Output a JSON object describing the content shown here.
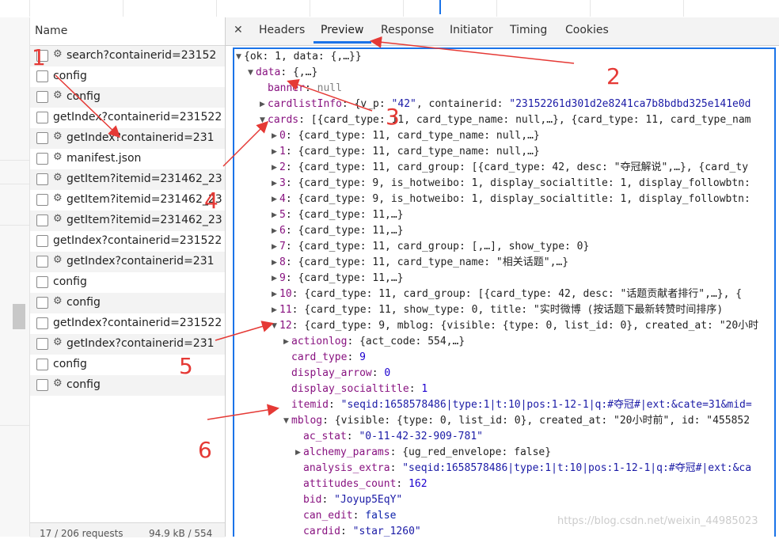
{
  "network": {
    "name_header": "Name",
    "requests": [
      {
        "label": "search?containerid=23152",
        "gear": true,
        "alt": true
      },
      {
        "label": "config",
        "gear": false,
        "alt": false
      },
      {
        "label": "config",
        "gear": true,
        "alt": true
      },
      {
        "label": "getIndex?containerid=231522",
        "gear": false,
        "alt": false
      },
      {
        "label": "getIndex?containerid=231",
        "gear": true,
        "alt": true
      },
      {
        "label": "manifest.json",
        "gear": true,
        "alt": false
      },
      {
        "label": "getItem?itemid=231462_23",
        "gear": true,
        "alt": true
      },
      {
        "label": "getItem?itemid=231462_23",
        "gear": true,
        "alt": false
      },
      {
        "label": "getItem?itemid=231462_23",
        "gear": true,
        "alt": true
      },
      {
        "label": "getIndex?containerid=231522",
        "gear": false,
        "alt": false
      },
      {
        "label": "getIndex?containerid=231",
        "gear": true,
        "alt": true
      },
      {
        "label": "config",
        "gear": false,
        "alt": false
      },
      {
        "label": "config",
        "gear": true,
        "alt": true
      },
      {
        "label": "getIndex?containerid=231522",
        "gear": false,
        "alt": false
      },
      {
        "label": "getIndex?containerid=231",
        "gear": true,
        "alt": true
      },
      {
        "label": "config",
        "gear": false,
        "alt": false
      },
      {
        "label": "config",
        "gear": true,
        "alt": true
      }
    ],
    "footer_requests": "17 / 206 requests",
    "footer_size": "94.9 kB / 554"
  },
  "tabs": {
    "close_glyph": "✕",
    "items": [
      "Headers",
      "Preview",
      "Response",
      "Initiator",
      "Timing",
      "Cookies"
    ],
    "active": "Preview"
  },
  "preview_lines": [
    {
      "tri": "open",
      "parts": [
        [
          "p",
          "{ok: 1, data: {,…}}"
        ]
      ]
    },
    {
      "tri": "open",
      "parts": [
        [
          "k",
          "data"
        ],
        [
          "p",
          ": {,…}"
        ]
      ]
    },
    {
      "tri": "",
      "parts": [
        [
          "k",
          "banner"
        ],
        [
          "p",
          ": "
        ],
        [
          "nl",
          "null"
        ]
      ]
    },
    {
      "tri": "closed",
      "parts": [
        [
          "k",
          "cardlistInfo"
        ],
        [
          "p",
          ": {v_p: "
        ],
        [
          "s",
          "\"42\""
        ],
        [
          "p",
          ", containerid: "
        ],
        [
          "s",
          "\"23152261d301d2e8241ca7b8bdbd325e141e0d"
        ]
      ]
    },
    {
      "tri": "open",
      "parts": [
        [
          "k",
          "cards"
        ],
        [
          "p",
          ": [{card_type: 11, card_type_name: null,…}, {card_type: 11, card_type_nam"
        ]
      ]
    },
    {
      "tri": "closed",
      "parts": [
        [
          "k",
          "0"
        ],
        [
          "p",
          ": {card_type: 11, card_type_name: null,…}"
        ]
      ]
    },
    {
      "tri": "closed",
      "parts": [
        [
          "k",
          "1"
        ],
        [
          "p",
          ": {card_type: 11, card_type_name: null,…}"
        ]
      ]
    },
    {
      "tri": "closed",
      "parts": [
        [
          "k",
          "2"
        ],
        [
          "p",
          ": {card_type: 11, card_group: [{card_type: 42, desc: \"夺冠解说\",…}, {card_ty"
        ]
      ]
    },
    {
      "tri": "closed",
      "parts": [
        [
          "k",
          "3"
        ],
        [
          "p",
          ": {card_type: 9, is_hotweibo: 1, display_socialtitle: 1, display_followbtn:"
        ]
      ]
    },
    {
      "tri": "closed",
      "parts": [
        [
          "k",
          "4"
        ],
        [
          "p",
          ": {card_type: 9, is_hotweibo: 1, display_socialtitle: 1, display_followbtn:"
        ]
      ]
    },
    {
      "tri": "closed",
      "parts": [
        [
          "k",
          "5"
        ],
        [
          "p",
          ": {card_type: 11,…}"
        ]
      ]
    },
    {
      "tri": "closed",
      "parts": [
        [
          "k",
          "6"
        ],
        [
          "p",
          ": {card_type: 11,…}"
        ]
      ]
    },
    {
      "tri": "closed",
      "parts": [
        [
          "k",
          "7"
        ],
        [
          "p",
          ": {card_type: 11, card_group: [,…], show_type: 0}"
        ]
      ]
    },
    {
      "tri": "closed",
      "parts": [
        [
          "k",
          "8"
        ],
        [
          "p",
          ": {card_type: 11, card_type_name: \"相关话题\",…}"
        ]
      ]
    },
    {
      "tri": "closed",
      "parts": [
        [
          "k",
          "9"
        ],
        [
          "p",
          ": {card_type: 11,…}"
        ]
      ]
    },
    {
      "tri": "closed",
      "parts": [
        [
          "k",
          "10"
        ],
        [
          "p",
          ": {card_type: 11, card_group: [{card_type: 42, desc: \"话题贡献者排行\",…}, {"
        ]
      ]
    },
    {
      "tri": "closed",
      "parts": [
        [
          "k",
          "11"
        ],
        [
          "p",
          ": {card_type: 11, show_type: 0, title: \"实时微博 (按话题下最新转赞时间排序)"
        ]
      ]
    },
    {
      "tri": "open",
      "parts": [
        [
          "k",
          "12"
        ],
        [
          "p",
          ": {card_type: 9, mblog: {visible: {type: 0, list_id: 0}, created_at: \"20小时"
        ]
      ]
    },
    {
      "tri": "closed",
      "parts": [
        [
          "k",
          "actionlog"
        ],
        [
          "p",
          ": {act_code: 554,…}"
        ]
      ]
    },
    {
      "tri": "",
      "parts": [
        [
          "k",
          "card_type"
        ],
        [
          "p",
          ": "
        ],
        [
          "n",
          "9"
        ]
      ]
    },
    {
      "tri": "",
      "parts": [
        [
          "k",
          "display_arrow"
        ],
        [
          "p",
          ": "
        ],
        [
          "n",
          "0"
        ]
      ]
    },
    {
      "tri": "",
      "parts": [
        [
          "k",
          "display_socialtitle"
        ],
        [
          "p",
          ": "
        ],
        [
          "n",
          "1"
        ]
      ]
    },
    {
      "tri": "",
      "parts": [
        [
          "k",
          "itemid"
        ],
        [
          "p",
          ": "
        ],
        [
          "s",
          "\"seqid:1658578486|type:1|t:10|pos:1-12-1|q:#夺冠#|ext:&cate=31&mid="
        ]
      ]
    },
    {
      "tri": "open",
      "parts": [
        [
          "k",
          "mblog"
        ],
        [
          "p",
          ": {visible: {type: 0, list_id: 0}, created_at: \"20小时前\", id: \"455852"
        ]
      ]
    },
    {
      "tri": "",
      "parts": [
        [
          "k",
          "ac_stat"
        ],
        [
          "p",
          ": "
        ],
        [
          "s",
          "\"0-11-42-32-909-781\""
        ]
      ]
    },
    {
      "tri": "closed",
      "parts": [
        [
          "k",
          "alchemy_params"
        ],
        [
          "p",
          ": {ug_red_envelope: false}"
        ]
      ]
    },
    {
      "tri": "",
      "parts": [
        [
          "k",
          "analysis_extra"
        ],
        [
          "p",
          ": "
        ],
        [
          "s",
          "\"seqid:1658578486|type:1|t:10|pos:1-12-1|q:#夺冠#|ext:&ca"
        ]
      ]
    },
    {
      "tri": "",
      "parts": [
        [
          "k",
          "attitudes_count"
        ],
        [
          "p",
          ": "
        ],
        [
          "n",
          "162"
        ]
      ]
    },
    {
      "tri": "",
      "parts": [
        [
          "k",
          "bid"
        ],
        [
          "p",
          ": "
        ],
        [
          "s",
          "\"Joyup5EqY\""
        ]
      ]
    },
    {
      "tri": "",
      "parts": [
        [
          "k",
          "can_edit"
        ],
        [
          "p",
          ": "
        ],
        [
          "b",
          "false"
        ]
      ]
    },
    {
      "tri": "",
      "parts": [
        [
          "k",
          "cardid"
        ],
        [
          "p",
          ": "
        ],
        [
          "s",
          "\"star_1260\""
        ]
      ]
    }
  ],
  "annotations": {
    "labels": [
      "1",
      "2",
      "3",
      "4",
      "5",
      "6"
    ],
    "color": "#e53935"
  },
  "watermark": "https://blog.csdn.net/weixin_44985023",
  "colors": {
    "accent": "#1a73e8",
    "key": "#881280",
    "string": "#1a1aa6",
    "number": "#1c00cf"
  }
}
